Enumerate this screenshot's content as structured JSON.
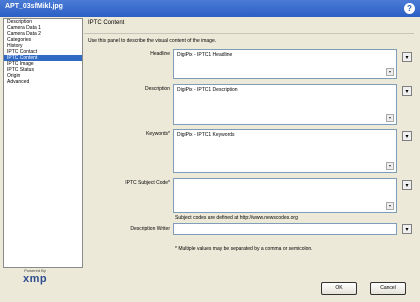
{
  "window": {
    "title": "APT_03sfMikl.jpg",
    "help_icon": "?"
  },
  "sidebar": {
    "items": [
      {
        "label": "Description",
        "selected": false
      },
      {
        "label": "Camera Data 1",
        "selected": false
      },
      {
        "label": "Camera Data 2",
        "selected": false
      },
      {
        "label": "Categories",
        "selected": false
      },
      {
        "label": "History",
        "selected": false
      },
      {
        "label": "IPTC Contact",
        "selected": false
      },
      {
        "label": "IPTC Content",
        "selected": true
      },
      {
        "label": "IPTC Image",
        "selected": false
      },
      {
        "label": "IPTC Status",
        "selected": false
      },
      {
        "label": "Origin",
        "selected": false
      },
      {
        "label": "Advanced",
        "selected": false
      }
    ]
  },
  "logo": {
    "powered_by": "Powered By",
    "brand": "xmp"
  },
  "panel": {
    "title": "IPTC Content",
    "description": "Use this panel to describe the visual content of the image.",
    "fields": {
      "headline": {
        "label": "Headline",
        "value": "DigiPix - IPTC1 Headline"
      },
      "description": {
        "label": "Description",
        "value": "DigiPix - IPTC1 Description"
      },
      "keywords": {
        "label": "Keywords*",
        "value": "DigiPix - IPTC1 Keywords"
      },
      "subject_code": {
        "label": "IPTC Subject Code*",
        "value": ""
      },
      "description_writer": {
        "label": "Description Writer",
        "value": ""
      }
    },
    "subject_note": "Subject codes are defined at http://www.newscodes.org",
    "multi_note": "* Multiple values may be separated by a comma or semicolon."
  },
  "buttons": {
    "ok": "OK",
    "cancel": "Cancel"
  }
}
